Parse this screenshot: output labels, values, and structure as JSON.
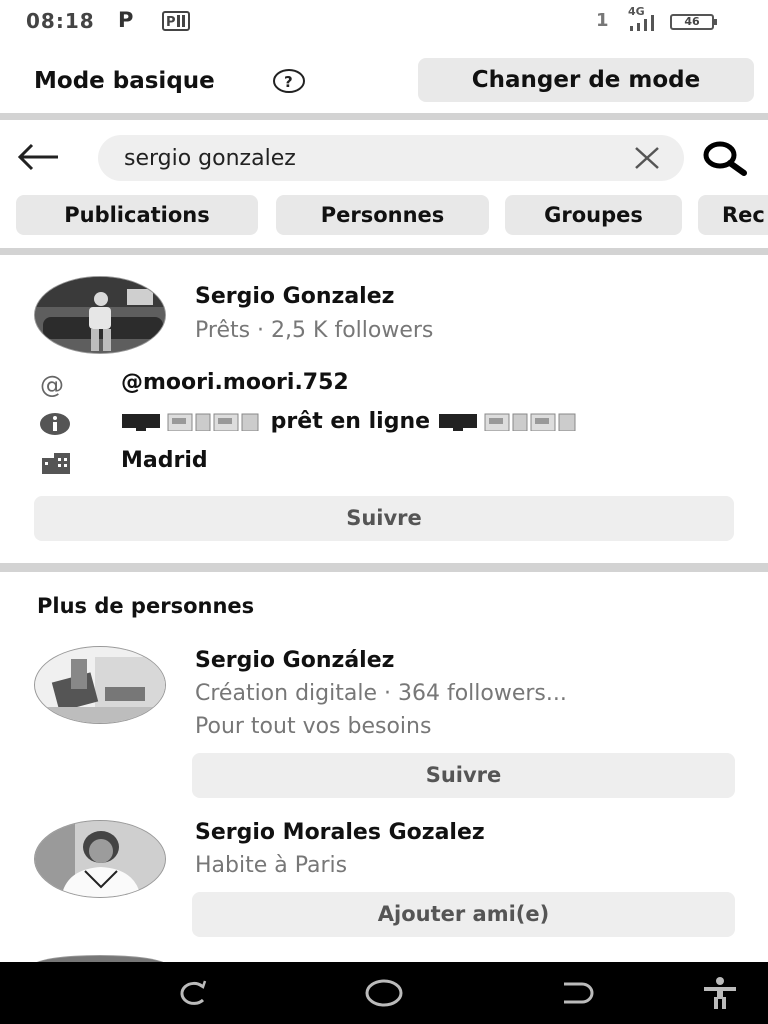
{
  "status_bar": {
    "time": "08:18",
    "p_label": "P",
    "signal_prefix": "1",
    "network": "4G",
    "battery": "46"
  },
  "mode_bar": {
    "title": "Mode basique",
    "switch_label": "Changer de mode"
  },
  "search": {
    "value": "sergio gonzalez"
  },
  "filters": [
    "Publications",
    "Personnes",
    "Groupes",
    "Rec"
  ],
  "top_result": {
    "name": "Sergio Gonzalez",
    "subtitle": "Prêts · 2,5 K followers",
    "username": "@moori.moori.752",
    "bio_text": "prêt en ligne",
    "location": "Madrid",
    "follow_label": "Suivre"
  },
  "more_people": {
    "title": "Plus de personnes",
    "people": [
      {
        "name": "Sergio González",
        "line1": "Création digitale · 364 followers...",
        "line2": "Pour tout vos besoins",
        "button": "Suivre"
      },
      {
        "name": "Sergio Morales Gozalez",
        "line1": "Habite à Paris",
        "button": "Ajouter ami(e)"
      }
    ]
  },
  "icons": {
    "help": "question-circle-icon",
    "back": "arrow-left-icon",
    "clear": "close-icon",
    "search": "search-icon",
    "at": "at-icon",
    "info": "info-icon",
    "building": "building-icon"
  }
}
